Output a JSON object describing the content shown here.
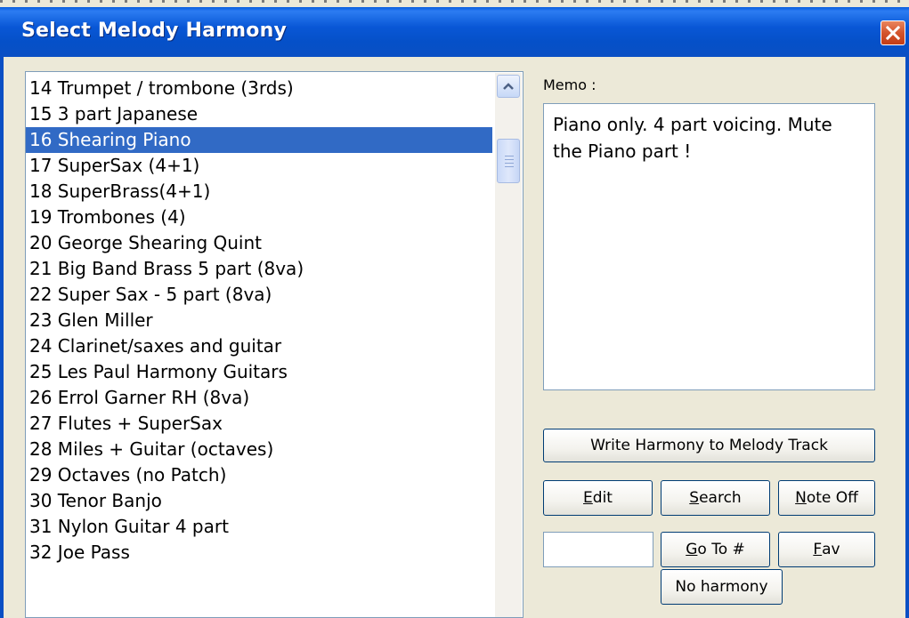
{
  "window": {
    "title": "Select Melody Harmony"
  },
  "list": {
    "items": [
      "14 Trumpet / trombone (3rds)",
      "15 3 part Japanese",
      "16 Shearing Piano",
      "17 SuperSax (4+1)",
      "18 SuperBrass(4+1)",
      "19 Trombones (4)",
      "20 George Shearing Quint",
      "21 Big Band Brass 5 part (8va)",
      "22 Super Sax - 5 part (8va)",
      "23 Glen Miller",
      "24 Clarinet/saxes and guitar",
      "25 Les Paul Harmony Guitars",
      "26 Errol Garner RH (8va)",
      "27 Flutes + SuperSax",
      "28 Miles + Guitar (octaves)",
      "29 Octaves (no Patch)",
      "30 Tenor Banjo",
      "31 Nylon Guitar 4 part",
      "32 Joe Pass"
    ],
    "selected": "16 Shearing Piano"
  },
  "memo": {
    "label": "Memo :",
    "text": "Piano only. 4 part voicing. Mute the Piano part !"
  },
  "buttons": {
    "write": "Write Harmony to Melody Track",
    "edit_mn": "E",
    "edit_rest": "dit",
    "search_mn": "S",
    "search_rest": "earch",
    "noteoff_mn": "N",
    "noteoff_rest": "ote Off",
    "goto_mn": "G",
    "goto_rest": "o To #",
    "fav_mn": "F",
    "fav_rest": "av",
    "noharmony": "No harmony"
  },
  "goto_input": {
    "value": ""
  },
  "colors": {
    "titlebar": "#0A5EDD",
    "selection": "#316AC5",
    "close": "#D4542C",
    "dialog_bg": "#ECE9D8"
  }
}
